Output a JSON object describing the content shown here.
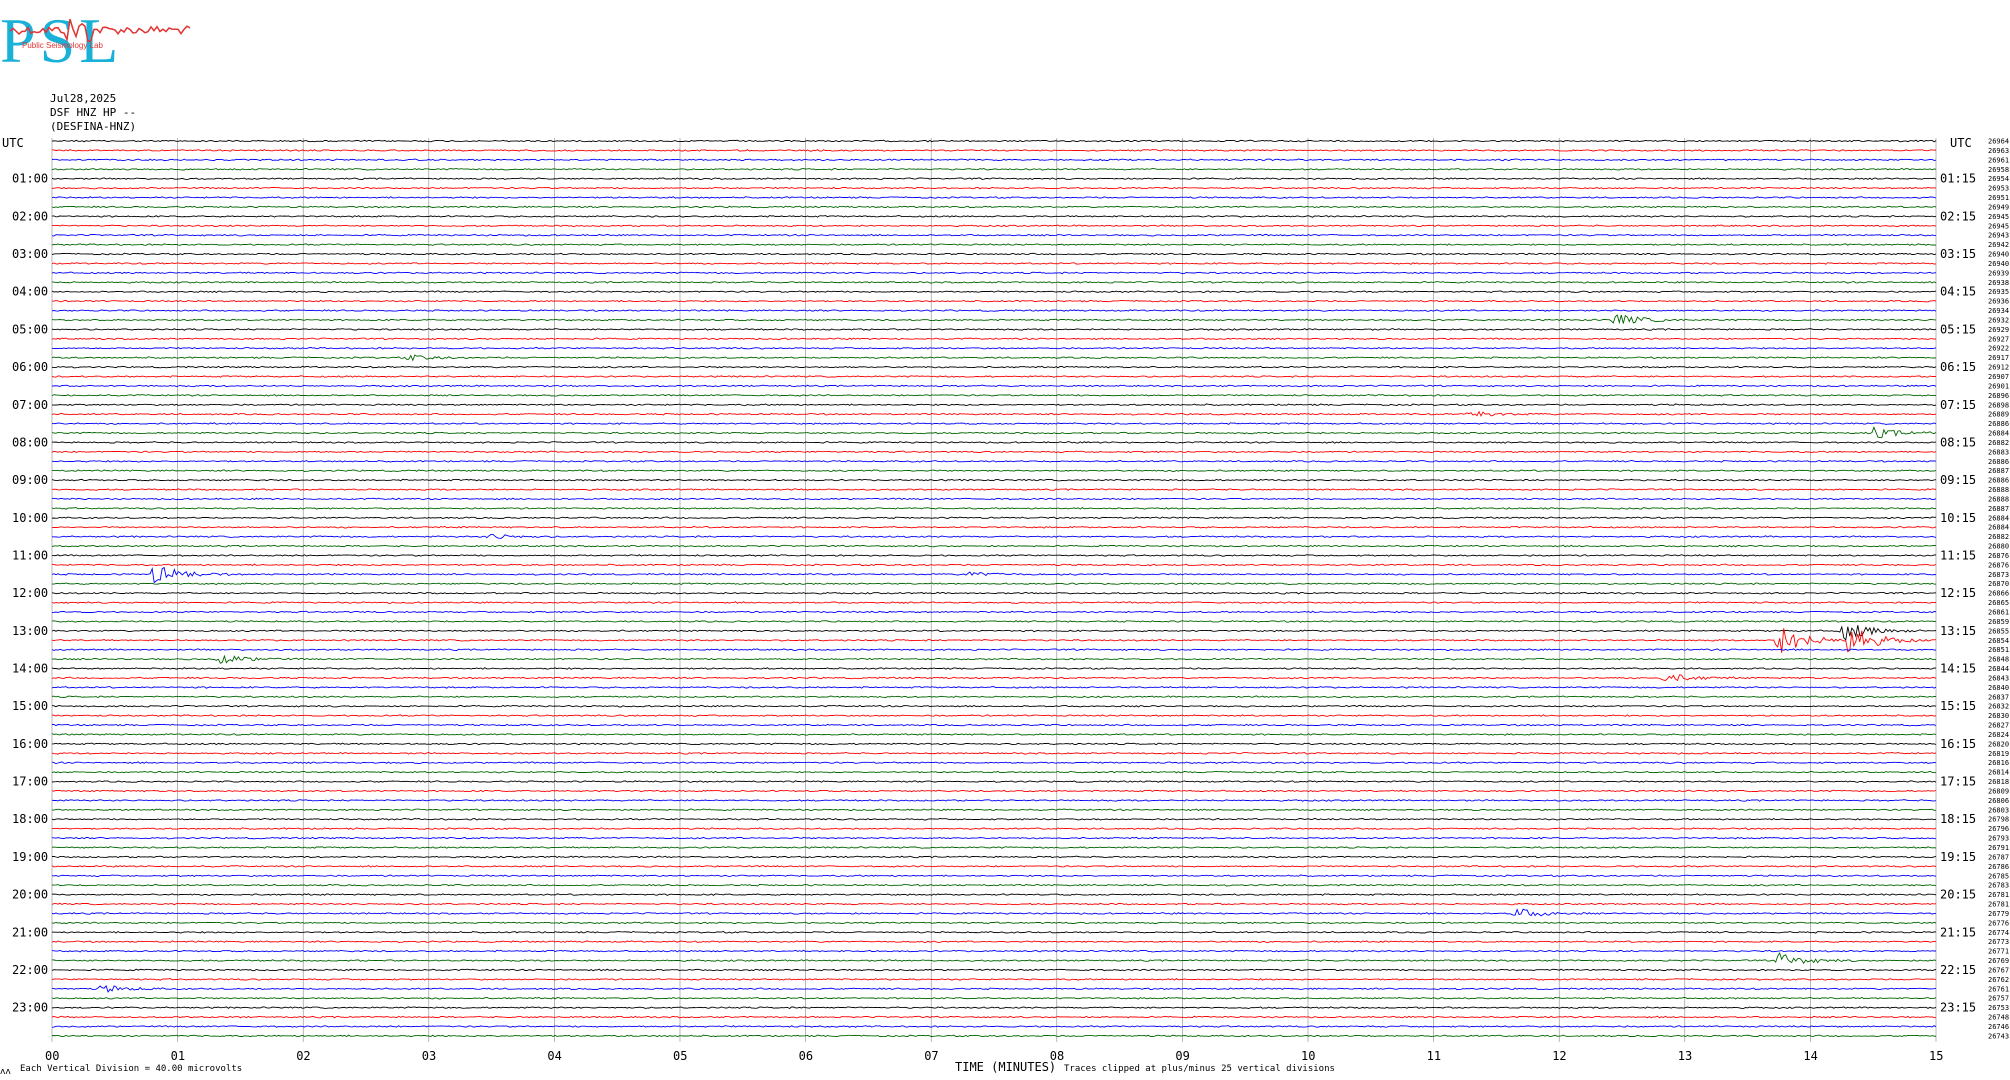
{
  "header": {
    "logo_letters": "PSL",
    "logo_text": "Public Seismology Lab",
    "date": "Jul28,2025",
    "station": "DSF HNZ HP --",
    "channel": "(DESFINA-HNZ)"
  },
  "colors": {
    "black": "#000000",
    "red": "#ff0000",
    "blue": "#0000ff",
    "green": "#006400",
    "logo": "#1ab1d8",
    "logo_wave": "#e23434"
  },
  "chart_data": {
    "type": "line",
    "subtype": "helicorder",
    "left_axis_title": "UTC",
    "right_axis_title": "UTC",
    "left_hour_labels": [
      "01:00",
      "02:00",
      "03:00",
      "04:00",
      "05:00",
      "06:00",
      "07:00",
      "08:00",
      "09:00",
      "10:00",
      "11:00",
      "12:00",
      "13:00",
      "14:00",
      "15:00",
      "16:00",
      "17:00",
      "18:00",
      "19:00",
      "20:00",
      "21:00",
      "22:00",
      "23:00"
    ],
    "right_hour_labels": [
      "01:15",
      "02:15",
      "03:15",
      "04:15",
      "05:15",
      "06:15",
      "07:15",
      "08:15",
      "09:15",
      "10:15",
      "11:15",
      "12:15",
      "13:15",
      "14:15",
      "15:15",
      "16:15",
      "17:15",
      "18:15",
      "19:15",
      "20:15",
      "21:15",
      "22:15",
      "23:15"
    ],
    "x_ticks": [
      "00",
      "01",
      "02",
      "03",
      "04",
      "05",
      "06",
      "07",
      "08",
      "09",
      "10",
      "11",
      "12",
      "13",
      "14",
      "15"
    ],
    "xlabel": "TIME (MINUTES)",
    "xlim": [
      0,
      15
    ],
    "traces_count": 96,
    "trace_color_cycle": [
      "black",
      "red",
      "blue",
      "green"
    ],
    "right_trace_values": [
      "26964",
      "26963",
      "26961",
      "26958",
      "26954",
      "26953",
      "26951",
      "26949",
      "26945",
      "26945",
      "26943",
      "26942",
      "26940",
      "26940",
      "26939",
      "26938",
      "26935",
      "26936",
      "26934",
      "26932",
      "26929",
      "26927",
      "26922",
      "26917",
      "26912",
      "26907",
      "26901",
      "26896",
      "26898",
      "26889",
      "26886",
      "26884",
      "26882",
      "26883",
      "26886",
      "26887",
      "26886",
      "26888",
      "26888",
      "26887",
      "26884",
      "26884",
      "26882",
      "26880",
      "26876",
      "26876",
      "26873",
      "26870",
      "26866",
      "26865",
      "26861",
      "26859",
      "26855",
      "26854",
      "26851",
      "26848",
      "26844",
      "26843",
      "26840",
      "26837",
      "26832",
      "26830",
      "26827",
      "26824",
      "26820",
      "26819",
      "26816",
      "26814",
      "26818",
      "26809",
      "26806",
      "26803",
      "26798",
      "26796",
      "26793",
      "26791",
      "26787",
      "26786",
      "26785",
      "26783",
      "26781",
      "26781",
      "26779",
      "26776",
      "26774",
      "26773",
      "26771",
      "26769",
      "26767",
      "26762",
      "26761",
      "26757",
      "26753",
      "26748",
      "26746",
      "26743"
    ],
    "events": [
      {
        "trace": 19,
        "minute": 12.45,
        "amp": 1.4
      },
      {
        "trace": 46,
        "minute": 0.82,
        "amp": 2.2
      },
      {
        "trace": 53,
        "minute": 13.75,
        "amp": 3.5
      },
      {
        "trace": 53,
        "minute": 14.3,
        "amp": 3.8
      },
      {
        "trace": 52,
        "minute": 14.28,
        "amp": 2.0
      },
      {
        "trace": 55,
        "minute": 1.35,
        "amp": 1.0
      },
      {
        "trace": 57,
        "minute": 12.85,
        "amp": 1.1
      },
      {
        "trace": 31,
        "minute": 14.5,
        "amp": 1.2
      },
      {
        "trace": 82,
        "minute": 11.65,
        "amp": 1.2
      },
      {
        "trace": 87,
        "minute": 13.75,
        "amp": 1.6
      },
      {
        "trace": 90,
        "minute": 0.4,
        "amp": 0.8
      },
      {
        "trace": 29,
        "minute": 11.3,
        "amp": 0.7
      },
      {
        "trace": 23,
        "minute": 2.85,
        "amp": 0.6
      },
      {
        "trace": 42,
        "minute": 3.5,
        "amp": 0.6
      },
      {
        "trace": 46,
        "minute": 7.3,
        "amp": 0.5
      }
    ],
    "footer_left": "Each Vertical Division =   40.00 microvolts",
    "footer_right": "Traces clipped at plus/minus 25 vertical divisions",
    "footer_mark": "ʌʌ"
  }
}
